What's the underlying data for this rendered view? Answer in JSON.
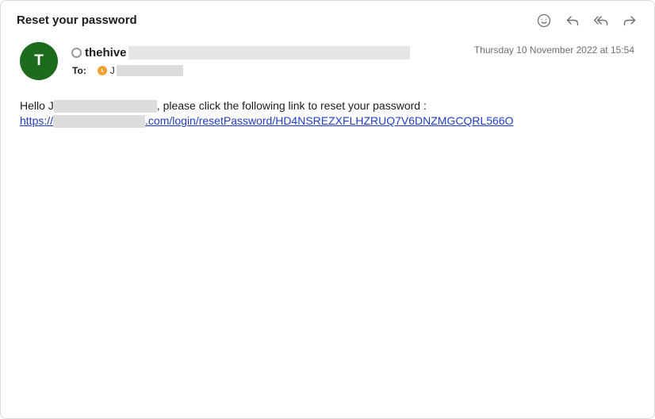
{
  "email": {
    "subject": "Reset your password",
    "sender": {
      "avatar_initial": "T",
      "avatar_color": "#1d6b1d",
      "name": "thehive"
    },
    "date": "Thursday 10 November 2022 at 15:54",
    "to_label": "To:",
    "recipient_initial": "J",
    "body": {
      "greeting_prefix": "Hello J",
      "greeting_suffix": ", please click the following link to reset your password :",
      "link_prefix": "https://",
      "link_suffix": ".com/login/resetPassword/HD4NSREZXFLHZRUQ7V6DNZMGCQRL566O"
    }
  },
  "toolbar": {
    "icons": [
      "smiley-icon",
      "reply-icon",
      "reply-all-icon",
      "forward-icon"
    ]
  },
  "colors": {
    "link": "#1f3dc9",
    "clock_badge": "#f0a030"
  }
}
